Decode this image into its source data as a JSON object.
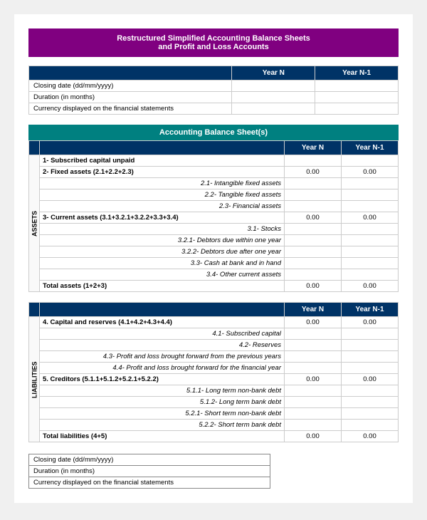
{
  "page": {
    "title_line1": "Restructured Simplified Accounting Balance Sheets",
    "title_line2": "and Profit and Loss Accounts"
  },
  "top_table": {
    "col1_header": "",
    "col2_header": "Year N",
    "col3_header": "Year N-1",
    "rows": [
      "Closing date (dd/mm/yyyy)",
      "Duration (in months)",
      "Currency displayed on the financial statements"
    ]
  },
  "balance_sheet": {
    "section_title": "Accounting Balance Sheet(s)",
    "col2_header": "Year N",
    "col3_header": "Year N-1",
    "assets_label": "ASSETS",
    "liabilities_label": "LIABILITIES",
    "assets_rows": [
      {
        "label": "1- Subscribed capital unpaid",
        "indent": 0,
        "bold": true,
        "yearN": "",
        "yearN1": ""
      },
      {
        "label": "2- Fixed assets (2.1+2.2+2.3)",
        "indent": 0,
        "bold": true,
        "yearN": "0.00",
        "yearN1": "0.00"
      },
      {
        "label": "2.1- Intangible fixed assets",
        "indent": 2,
        "bold": false,
        "yearN": "",
        "yearN1": ""
      },
      {
        "label": "2.2- Tangible fixed assets",
        "indent": 2,
        "bold": false,
        "yearN": "",
        "yearN1": ""
      },
      {
        "label": "2.3- Financial assets",
        "indent": 2,
        "bold": false,
        "yearN": "",
        "yearN1": ""
      },
      {
        "label": "3- Current assets (3.1+3.2.1+3.2.2+3.3+3.4)",
        "indent": 0,
        "bold": true,
        "yearN": "0.00",
        "yearN1": "0.00"
      },
      {
        "label": "3.1- Stocks",
        "indent": 2,
        "bold": false,
        "yearN": "",
        "yearN1": ""
      },
      {
        "label": "3.2.1- Debtors due within one year",
        "indent": 3,
        "bold": false,
        "yearN": "",
        "yearN1": ""
      },
      {
        "label": "3.2.2- Debtors due after one year",
        "indent": 3,
        "bold": false,
        "yearN": "",
        "yearN1": ""
      },
      {
        "label": "3.3- Cash at bank and in hand",
        "indent": 2,
        "bold": false,
        "yearN": "",
        "yearN1": ""
      },
      {
        "label": "3.4- Other current assets",
        "indent": 2,
        "bold": false,
        "yearN": "",
        "yearN1": ""
      },
      {
        "label": "Total assets (1+2+3)",
        "indent": 0,
        "bold": true,
        "yearN": "0.00",
        "yearN1": "0.00"
      }
    ],
    "liabilities_rows": [
      {
        "label": "4. Capital and reserves (4.1+4.2+4.3+4.4)",
        "indent": 0,
        "bold": true,
        "yearN": "0.00",
        "yearN1": "0.00"
      },
      {
        "label": "4.1- Subscribed capital",
        "indent": 2,
        "bold": false,
        "yearN": "",
        "yearN1": ""
      },
      {
        "label": "4.2- Reserves",
        "indent": 2,
        "bold": false,
        "yearN": "",
        "yearN1": ""
      },
      {
        "label": "4.3- Profit and loss brought forward from the previous years",
        "indent": 2,
        "bold": false,
        "yearN": "",
        "yearN1": ""
      },
      {
        "label": "4.4- Profit and loss brought forward for the financial year",
        "indent": 2,
        "bold": false,
        "yearN": "",
        "yearN1": ""
      },
      {
        "label": "5. Creditors (5.1.1+5.1.2+5.2.1+5.2.2)",
        "indent": 0,
        "bold": true,
        "yearN": "0.00",
        "yearN1": "0.00"
      },
      {
        "label": "5.1.1- Long term non-bank debt",
        "indent": 2,
        "bold": false,
        "yearN": "",
        "yearN1": ""
      },
      {
        "label": "5.1.2- Long term bank debt",
        "indent": 2,
        "bold": false,
        "yearN": "",
        "yearN1": ""
      },
      {
        "label": "5.2.1- Short term non-bank debt",
        "indent": 2,
        "bold": false,
        "yearN": "",
        "yearN1": ""
      },
      {
        "label": "5.2.2- Short term bank debt",
        "indent": 2,
        "bold": false,
        "yearN": "",
        "yearN1": ""
      },
      {
        "label": "Total liabilities (4+5)",
        "indent": 0,
        "bold": true,
        "yearN": "0.00",
        "yearN1": "0.00"
      }
    ]
  },
  "bottom_table": {
    "rows": [
      "Closing date (dd/mm/yyyy)",
      "Duration (in months)",
      "Currency displayed on the financial statements"
    ]
  }
}
